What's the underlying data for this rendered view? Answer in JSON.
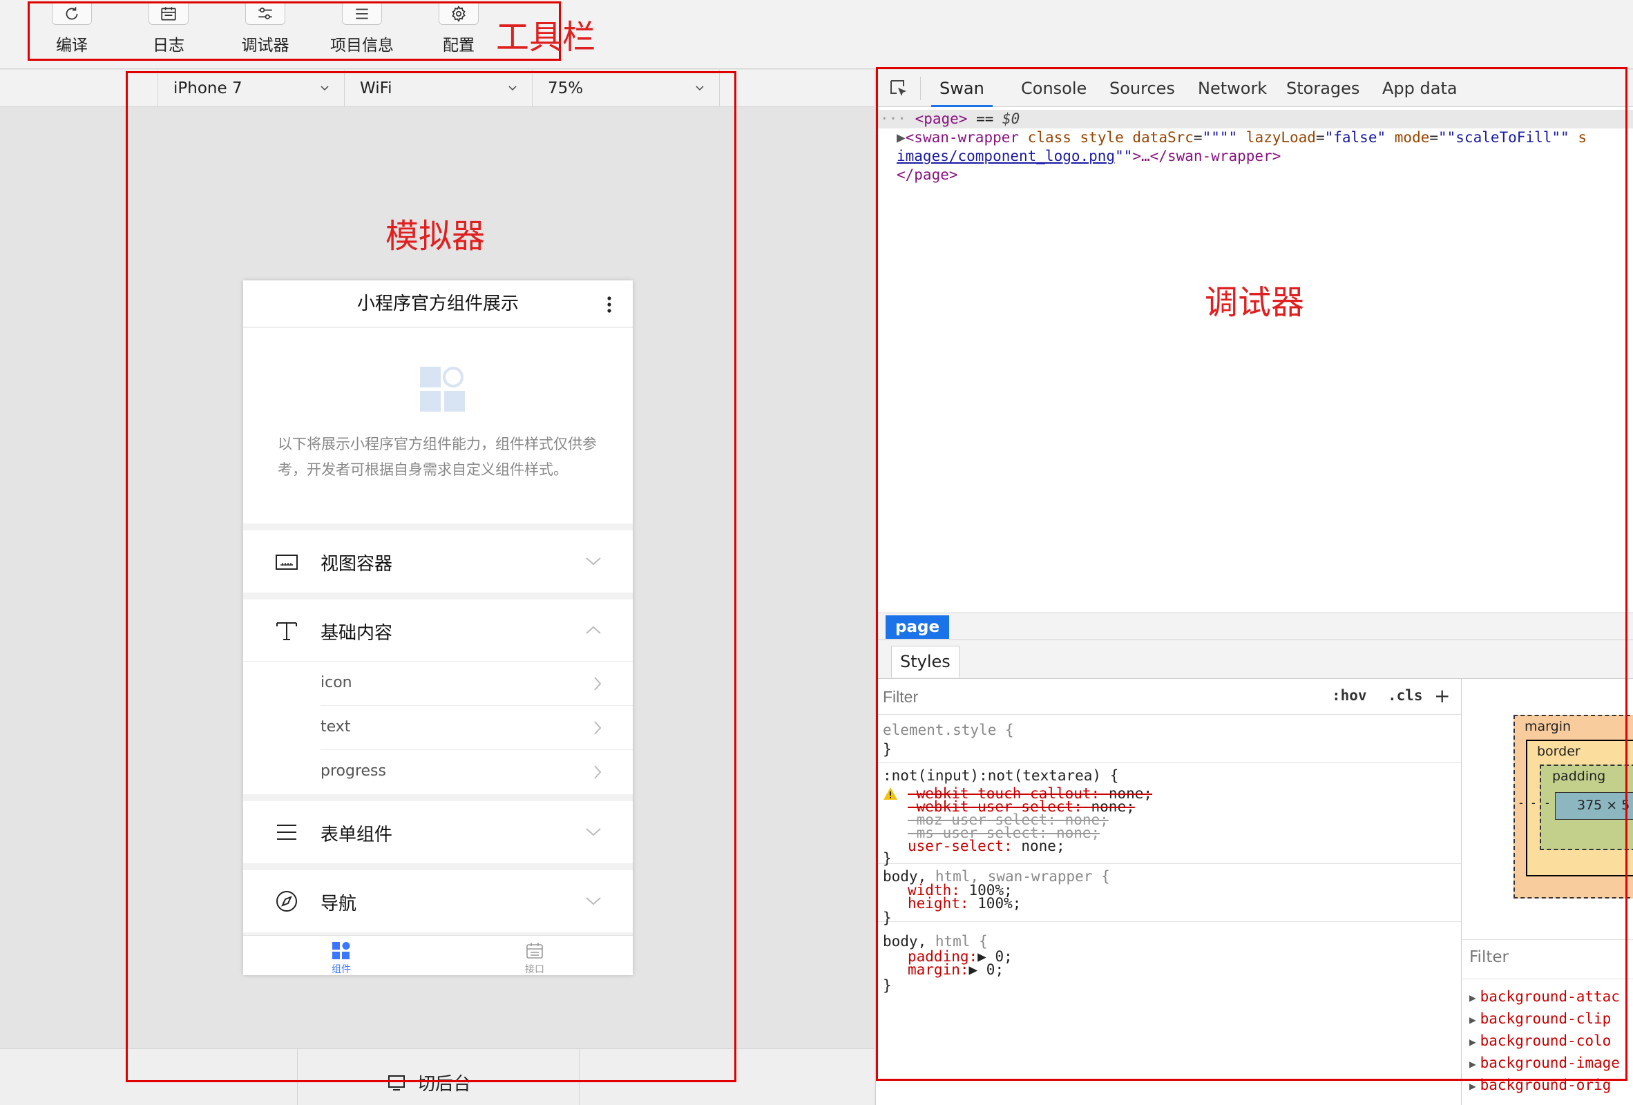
{
  "toolbar": {
    "buttons": [
      {
        "label": "编译",
        "icon": "refresh-icon"
      },
      {
        "label": "日志",
        "icon": "calendar-icon"
      },
      {
        "label": "调试器",
        "icon": "sliders-icon"
      },
      {
        "label": "项目信息",
        "icon": "list-icon"
      },
      {
        "label": "配置",
        "icon": "gear-icon"
      }
    ]
  },
  "simulator": {
    "device": "iPhone 7",
    "network": "WiFi",
    "zoom": "75%",
    "background_button": "切后台",
    "phone": {
      "title": "小程序官方组件展示",
      "intro": "以下将展示小程序官方组件能力，组件样式仅供参考，开发者可根据自身需求自定义组件样式。",
      "sections": [
        {
          "title": "视图容器",
          "icon": "view-container-icon",
          "expanded": false
        },
        {
          "title": "基础内容",
          "icon": "text-format-icon",
          "expanded": true,
          "items": [
            "icon",
            "text",
            "progress"
          ]
        },
        {
          "title": "表单组件",
          "icon": "menu-lines-icon",
          "expanded": false
        },
        {
          "title": "导航",
          "icon": "compass-icon",
          "expanded": false
        }
      ],
      "tabs": [
        {
          "label": "组件",
          "active": true
        },
        {
          "label": "接口",
          "active": false
        }
      ],
      "colors": {
        "accent": "#3c76ff"
      }
    }
  },
  "devtools": {
    "tabs": [
      "Swan",
      "Console",
      "Sources",
      "Network",
      "Storages",
      "App data"
    ],
    "active_tab": "Swan",
    "dom": {
      "row1": {
        "tag_open": "<page>",
        "eq": " == ",
        "ref": "$0"
      },
      "row2": {
        "open": "<swan-wrapper ",
        "attrs": "class style ",
        "a1n": "dataSrc",
        "a1v": "\"\"\"\"",
        "a2n": "lazyLoad",
        "a2v": "\"false\"",
        "a3n": "mode",
        "a3v": "\"\"scaleToFill\"\"",
        "tail": " s"
      },
      "row3": {
        "link": "images/component_logo.png",
        "quote": "\"\"",
        "ellipsis": ">…</swan-wrapper>"
      },
      "row4": "</page>"
    },
    "breadcrumb": "page",
    "styles_tab": "Styles",
    "filter_placeholder": "Filter",
    "hov": ":hov",
    "cls": ".cls",
    "plus": "+",
    "rules": {
      "r1_selector": "element.style {",
      "r2_selector": ":not(input):not(textarea) {",
      "r2_props": [
        {
          "name": "-webkit-touch-callout",
          "value": "none;"
        },
        {
          "name": "-webkit-user-select",
          "value": "none;"
        },
        {
          "name": "-moz-user-select",
          "value": "none;"
        },
        {
          "name": "-ms-user-select",
          "value": "none;"
        },
        {
          "name": "user-select",
          "value": "none;"
        }
      ],
      "r3_selector_a": "body,",
      "r3_selector_b": " html, swan-wrapper {",
      "r3_props": [
        {
          "name": "width",
          "value": "100%;"
        },
        {
          "name": "height",
          "value": "100%;"
        }
      ],
      "r4_selector_a": "body,",
      "r4_selector_b": " html {",
      "r4_props": [
        {
          "name": "padding",
          "value": "▶ 0;"
        },
        {
          "name": "margin",
          "value": "▶ 0;"
        }
      ],
      "close": "}"
    },
    "box_model": {
      "margin": "margin",
      "border": "border",
      "padding": "padding",
      "content": "375 × 5",
      "dash": "-"
    },
    "computed_filter": "Filter",
    "computed_props": [
      "background-attac",
      "background-clip",
      "background-colo",
      "background-image",
      "background-orig"
    ]
  },
  "annotations": {
    "toolbar": "工具栏",
    "simulator": "模拟器",
    "debugger": "调试器"
  }
}
